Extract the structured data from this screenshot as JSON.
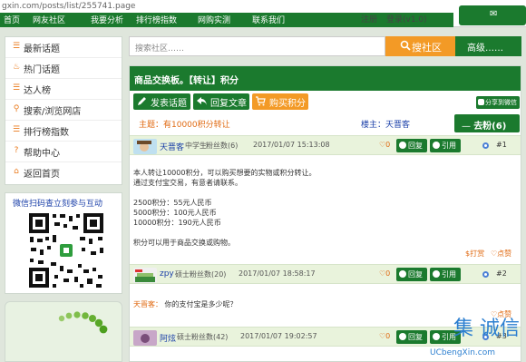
{
  "browser": {
    "url": "gxin.com/posts/list/255741.page"
  },
  "topnav": {
    "items": [
      "首页",
      "网友社区",
      "我要分析",
      "排行榜指数",
      "网购实测",
      "联系我们"
    ],
    "right_a": "注册",
    "right_b": "登录(v1.0)"
  },
  "sidebar": {
    "items": [
      {
        "label": "最新话题",
        "icon": "list-icon"
      },
      {
        "label": "热门话题",
        "icon": "fire-icon"
      },
      {
        "label": "达人榜",
        "icon": "list-icon"
      },
      {
        "label": "搜索/浏览网店",
        "icon": "search-icon"
      },
      {
        "label": "排行榜指数",
        "icon": "list-icon"
      },
      {
        "label": "帮助中心",
        "icon": "help-icon"
      },
      {
        "label": "返回首页",
        "icon": "home-icon"
      }
    ],
    "qr_title": "微信扫码查立刻参与互动"
  },
  "search": {
    "placeholder": "搜索社区……",
    "button": "搜社区",
    "advanced": "高级……"
  },
  "board": {
    "title": "商品交换板。【转让】积分",
    "actions": {
      "new_topic": "发表话题",
      "reply": "回复文章",
      "buy_points": "购买积分"
    },
    "share": "分享到微信",
    "topic": "主题：有10000积分转让",
    "owner": "楼主：天晋客",
    "goto": "去粉(6)"
  },
  "posts": [
    {
      "user": "天晋客",
      "level": "中学生",
      "fans": "粉丝数(6)",
      "time": "2017/01/07 15:13:08",
      "likes": "0",
      "reply": "回复",
      "quote": "引用",
      "floor": "#1",
      "lines": [
        "本人转让10000积分，可以购买想要的实物或积分转让。",
        "通过支付宝交易，有意者请联系。",
        "",
        "2500积分：55元人民币",
        "5000积分：100元人民币",
        "10000积分：190元人民币",
        "",
        "积分可以用于商品交换或购物。"
      ],
      "tip": "打赏",
      "praise": "点赞"
    },
    {
      "user": "zpy",
      "level": "硕士",
      "fans": "粉丝数(20)",
      "time": "2017/01/07 18:58:17",
      "likes": "0",
      "reply": "回复",
      "quote": "引用",
      "floor": "#2",
      "reply_name": "天晋客：",
      "reply_text": "你的支付宝是多少呢？",
      "praise": "点赞"
    },
    {
      "user": "阿炫",
      "level": "硕士",
      "fans": "粉丝数(42)",
      "time": "2017/01/07 19:02:57",
      "likes": "0",
      "reply": "回复",
      "quote": "引用",
      "floor": "#3"
    }
  ],
  "watermark": {
    "big": "集 诚信",
    "small": "UCbengXin.com"
  },
  "colors": {
    "green": "#1b7a2e",
    "orange": "#f39a26",
    "link": "#1a3fa8",
    "accent": "#e06a12"
  }
}
